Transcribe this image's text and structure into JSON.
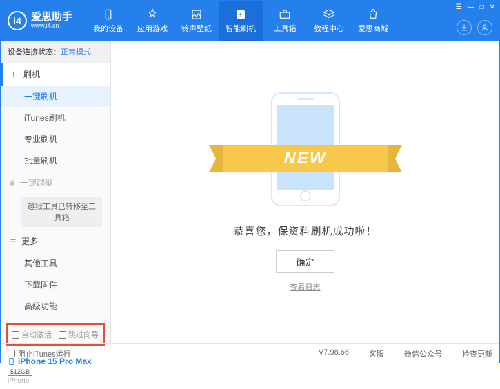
{
  "app": {
    "title": "爱思助手",
    "subtitle": "www.i4.cn"
  },
  "window": {
    "menu": "☰",
    "min": "—",
    "max": "□",
    "close": "✕"
  },
  "nav": {
    "items": [
      {
        "label": "我的设备"
      },
      {
        "label": "应用游戏"
      },
      {
        "label": "铃声壁纸"
      },
      {
        "label": "智能刷机"
      },
      {
        "label": "工具箱"
      },
      {
        "label": "教程中心"
      },
      {
        "label": "爱思商城"
      }
    ]
  },
  "status": {
    "label": "设备连接状态：",
    "value": "正常模式"
  },
  "sidebar": {
    "flash_header": "刷机",
    "items": {
      "oneclick": "一键刷机",
      "itunes": "iTunes刷机",
      "pro": "专业刷机",
      "batch": "批量刷机"
    },
    "jailbreak": "一键越狱",
    "jailbreak_note": "越狱工具已转移至工具箱",
    "more_header": "更多",
    "more": {
      "other": "其他工具",
      "download": "下载固件",
      "advanced": "高级功能"
    },
    "auto_activate": "自动激活",
    "skip_guide": "跳过向导"
  },
  "device": {
    "name": "iPhone 15 Pro Max",
    "storage": "512GB",
    "type": "iPhone"
  },
  "main": {
    "badge": "NEW",
    "message": "恭喜您，保资料刷机成功啦！",
    "ok": "确定",
    "log": "查看日志"
  },
  "footer": {
    "block_itunes": "阻止iTunes运行",
    "version": "V7.98.66",
    "support": "客服",
    "wechat": "微信公众号",
    "update": "检查更新"
  }
}
